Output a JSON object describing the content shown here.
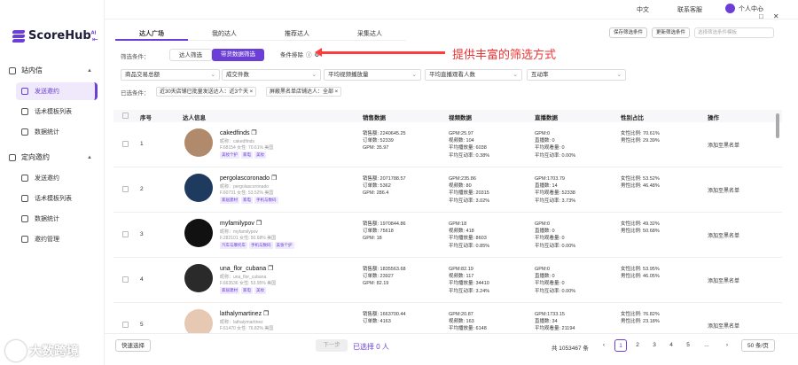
{
  "app": {
    "logo": "ScoreHub",
    "logo_sup": "AI"
  },
  "topbar": {
    "lang": "中文",
    "service": "联系客服",
    "user": "个人中心",
    "win": [
      "–",
      "□",
      "✕"
    ]
  },
  "sidebar": {
    "group1": "站内信",
    "items1": [
      "发送邀约",
      "话术模板列表",
      "数据统计"
    ],
    "group2": "定向邀约",
    "items2": [
      "发送邀约",
      "话术模板列表",
      "数据统计",
      "邀约管理"
    ]
  },
  "tabs": [
    "达人广场",
    "我的达人",
    "推荐达人",
    "采集达人"
  ],
  "top_right": {
    "save": "保存筛选条件",
    "update": "更新筛选条件",
    "select_placeholder": "选择筛选条件模板"
  },
  "filter": {
    "label": "筛选条件：",
    "seg1": "达人筛选",
    "seg2": "带货数据筛选",
    "seg3": "条件排除"
  },
  "annotation": "提供丰富的筛选方式",
  "dropdowns": [
    "商品交易总额",
    "成交件数",
    "平均视频播放量",
    "平均直播观看人数",
    "互动率"
  ],
  "selected": {
    "label": "已选条件：",
    "chips": [
      "近30天店铺已批量发送达人：近3个天 ×",
      "屏蔽黑名单店铺达人：全部 ×"
    ]
  },
  "table": {
    "headers": [
      "序号",
      "达人信息",
      "销售数据",
      "视频数据",
      "直播数据",
      "性别占比",
      "操作"
    ],
    "rows": [
      {
        "idx": "1",
        "name": "cakedfinds",
        "nick": "昵称：cakedfinds",
        "fans": "F.68154  女性: 70.61%  美国",
        "tags": [
          "美妆个护",
          "家电",
          "美妆"
        ],
        "sales": [
          "销售额: 2240645.25",
          "订单数: 52339",
          "GPM: 35.97"
        ],
        "video": [
          "GPM:25.97",
          "视频数: 104",
          "平均播放量: 6038",
          "平均互动率: 0.38%"
        ],
        "live": [
          "GPM:0",
          "直播数: 0",
          "平均观看量: 0",
          "平均互动率: 0.00%"
        ],
        "gender": [
          "女性比例: 70.61%",
          "男性比例: 29.39%"
        ],
        "action": "添加至黑名单"
      },
      {
        "idx": "2",
        "name": "pergolascoronado",
        "nick": "昵称：pergolascoronado",
        "fans": "F.60731  女性: 53.52%  美国",
        "tags": [
          "家居建材",
          "家电",
          "手机与数码"
        ],
        "sales": [
          "销售额: 2071788.57",
          "订单数: 5362",
          "GPM: 286.4"
        ],
        "video": [
          "GPM:235.86",
          "视频数: 80",
          "平均播放量: 20315",
          "平均互动率: 3.02%"
        ],
        "live": [
          "GPM:1703.79",
          "直播数: 14",
          "平均观看量: 52338",
          "平均互动率: 3.73%"
        ],
        "gender": [
          "女性比例: 53.52%",
          "男性比例: 46.48%"
        ],
        "action": "添加至黑名单"
      },
      {
        "idx": "3",
        "name": "myfamilypov",
        "nick": "昵称：myfamilypov",
        "fans": "F.282101  女性: 50.68%  美国",
        "tags": [
          "汽车与摩托车",
          "手机与数码",
          "美妆个护"
        ],
        "sales": [
          "销售额: 1970844.86",
          "订单数: 75618",
          "GPM: 18"
        ],
        "video": [
          "GPM:18",
          "视频数: 418",
          "平均播放量: 8603",
          "平均互动率: 0.85%"
        ],
        "live": [
          "GPM:0",
          "直播数: 0",
          "平均观看量: 0",
          "平均互动率: 0.00%"
        ],
        "gender": [
          "女性比例: 49.32%",
          "男性比例: 50.68%"
        ],
        "action": "添加至黑名单"
      },
      {
        "idx": "4",
        "name": "una_flor_cubana",
        "nick": "昵称：una_flor_cubana",
        "fans": "F.663536  女性: 53.95%  美国",
        "tags": [
          "家居建材",
          "家电",
          "美妆"
        ],
        "sales": [
          "销售额: 1835563.68",
          "订单数: 23927",
          "GPM: 82.19"
        ],
        "video": [
          "GPM:82.19",
          "视频数: 117",
          "平均播放量: 34410",
          "平均互动率: 3.24%"
        ],
        "live": [
          "GPM:0",
          "直播数: 0",
          "平均观看量: 0",
          "平均互动率: 0.00%"
        ],
        "gender": [
          "女性比例: 53.95%",
          "男性比例: 46.05%"
        ],
        "action": "添加至黑名单"
      },
      {
        "idx": "5",
        "name": "lathalymartinez",
        "nick": "昵称：lathalymartinez",
        "fans": "F.61470  女性: 76.82%  美国",
        "tags": [],
        "sales": [
          "销售额: 1663700.44",
          "订单数: 4163"
        ],
        "video": [
          "GPM:20.87",
          "视频数: 163",
          "平均播放量: 6148"
        ],
        "live": [
          "GPM:1733.15",
          "直播数: 34",
          "平均观看量: 21194"
        ],
        "gender": [
          "女性比例: 76.82%",
          "男性比例: 23.18%"
        ],
        "action": "添加至黑名单"
      }
    ]
  },
  "footer": {
    "quick": "快速选择",
    "next": "下一步",
    "selected": "已选择 0 人",
    "total": "共 1053467 条",
    "pages": [
      "1",
      "2",
      "3",
      "4",
      "5",
      "...",
      "›"
    ],
    "page_size": "50 条/页"
  },
  "watermark": "大数跨境",
  "colors": {
    "accent": "#6b3fd6",
    "annotation": "#ff3b3b"
  }
}
